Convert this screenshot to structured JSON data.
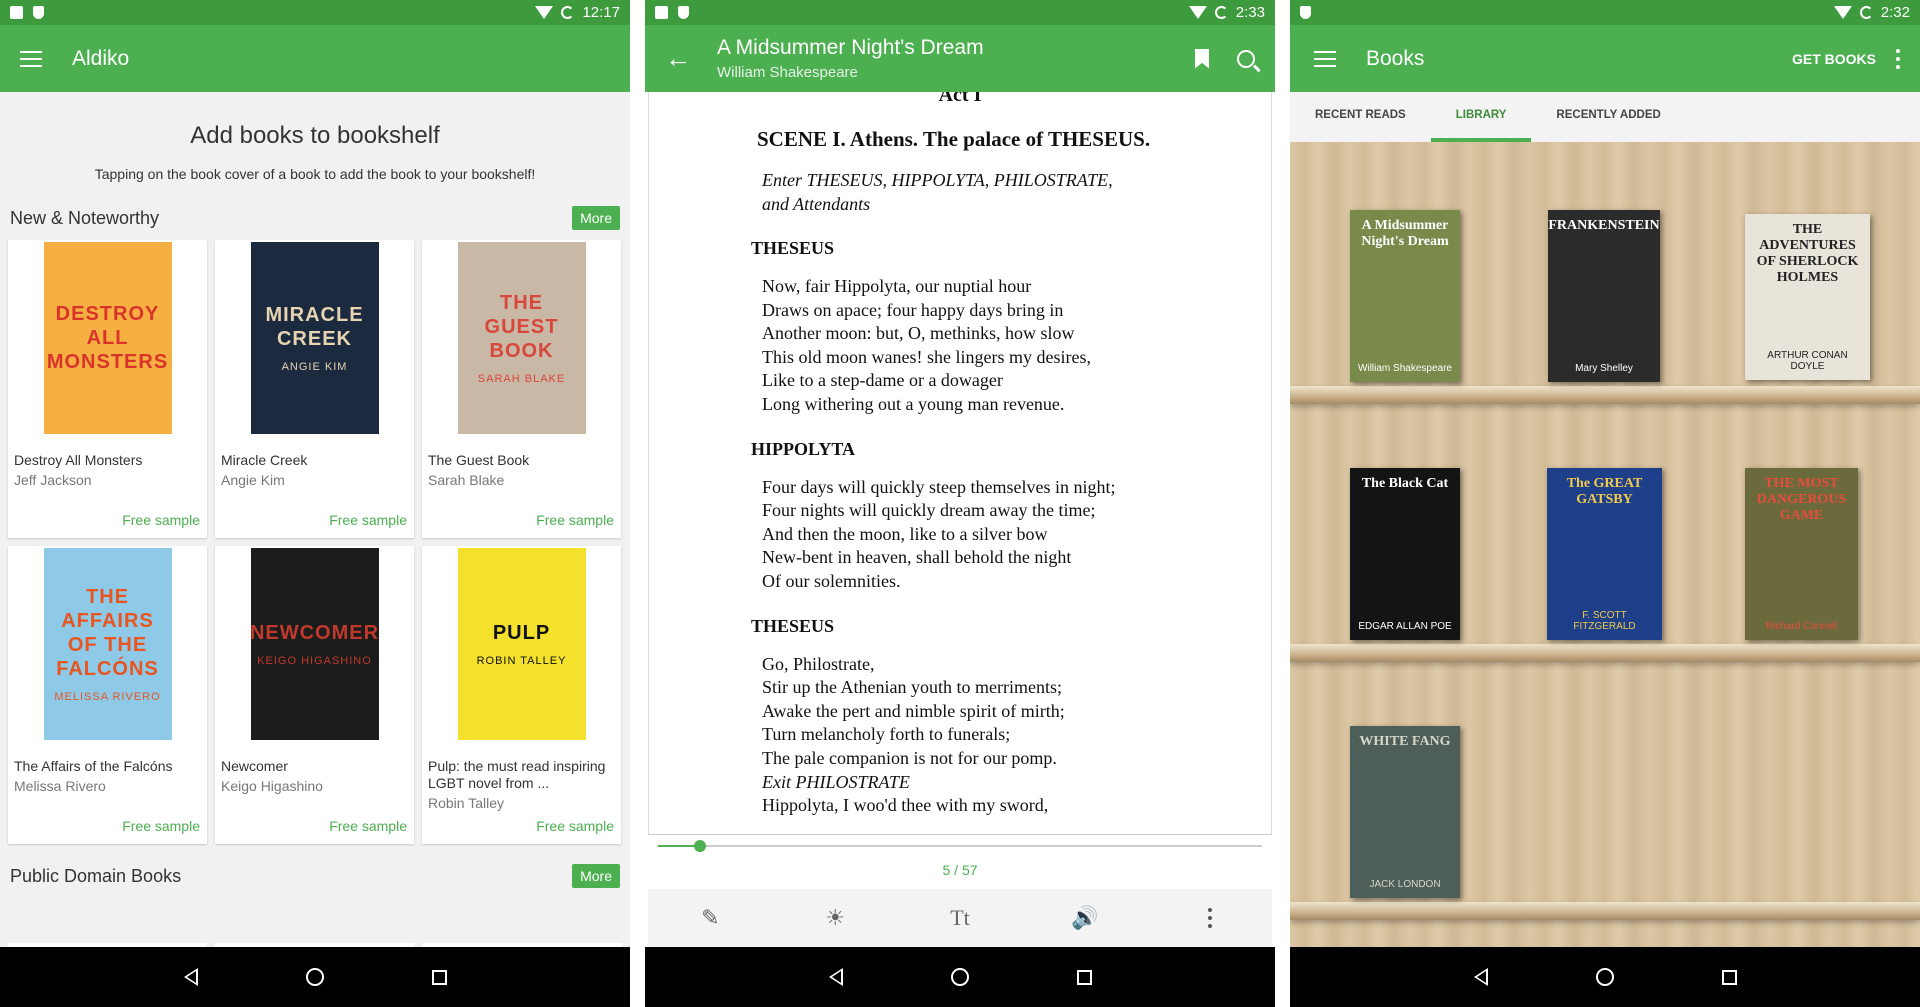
{
  "screen1": {
    "status": {
      "time": "12:17"
    },
    "appbar": {
      "title": "Aldiko"
    },
    "hero": {
      "title": "Add books to bookshelf",
      "subtitle": "Tapping on the book cover of a book to add the book to your bookshelf!"
    },
    "sections": [
      {
        "title": "New & Noteworthy",
        "more": "More"
      },
      {
        "title": "Public Domain Books",
        "more": "More"
      }
    ],
    "books": [
      {
        "title": "Destroy All Monsters",
        "author": "Jeff Jackson",
        "sample": "Free sample",
        "cover_text": "DESTROY ALL MONSTERS",
        "cover_color": "#f5b041",
        "cover_fg": "#d9342b"
      },
      {
        "title": "Miracle Creek",
        "author": "Angie Kim",
        "sample": "Free sample",
        "cover_text": "MIRACLE CREEK",
        "cover_sub": "ANGIE KIM",
        "cover_color": "#1b2a3e",
        "cover_fg": "#e6d3b0"
      },
      {
        "title": "The Guest Book",
        "author": "Sarah Blake",
        "sample": "Free sample",
        "cover_text": "THE GUEST BOOK",
        "cover_sub": "SARAH BLAKE",
        "cover_color": "#c9b8a6",
        "cover_fg": "#d9463a"
      },
      {
        "title": "The Affairs of the Falcóns",
        "author": "Melissa Rivero",
        "sample": "Free sample",
        "cover_text": "THE AFFAIRS OF THE FALCÓNS",
        "cover_sub": "MELISSA RIVERO",
        "cover_color": "#8fc9e8",
        "cover_fg": "#e8551f"
      },
      {
        "title": "Newcomer",
        "author": "Keigo Higashino",
        "sample": "Free sample",
        "cover_text": "NEWCOMER",
        "cover_sub": "KEIGO HIGASHINO",
        "cover_color": "#1c1c1c",
        "cover_fg": "#c0392b"
      },
      {
        "title": "Pulp: the must read inspiring LGBT novel from ...",
        "author": "Robin Talley",
        "sample": "Free sample",
        "cover_text": "PULP",
        "cover_sub": "ROBIN TALLEY",
        "cover_color": "#f4e12b",
        "cover_fg": "#111111"
      }
    ]
  },
  "screen2": {
    "status": {
      "time": "2:33"
    },
    "appbar": {
      "title": "A Midsummer Night's Dream",
      "author": "William Shakespeare"
    },
    "text": {
      "act": "Act I",
      "scene": "SCENE I. Athens. The palace of THESEUS.",
      "stage": [
        "Enter THESEUS, HIPPOLYTA, PHILOSTRATE,",
        "and Attendants"
      ],
      "speech1": {
        "speaker": "THESEUS",
        "lines": [
          "Now, fair Hippolyta, our nuptial hour",
          "Draws on apace; four happy days bring in",
          "Another moon: but, O, methinks, how slow",
          "This old moon wanes! she lingers my desires,",
          "Like to a step-dame or a dowager",
          "Long withering out a young man revenue."
        ]
      },
      "speech2": {
        "speaker": "HIPPOLYTA",
        "lines": [
          "Four days will quickly steep themselves in night;",
          "Four nights will quickly dream away the time;",
          "And then the moon, like to a silver bow",
          "New-bent in heaven, shall behold the night",
          "Of our solemnities."
        ]
      },
      "speech3": {
        "speaker": "THESEUS",
        "lines": [
          "Go, Philostrate,",
          "Stir up the Athenian youth to merriments;",
          "Awake the pert and nimble spirit of mirth;",
          "Turn melancholy forth to funerals;",
          "The pale companion is not for our pomp."
        ],
        "exit": "Exit PHILOSTRATE",
        "cut_line": "Hippolyta, I woo'd thee with my sword,"
      }
    },
    "progress": {
      "label": "5 / 57",
      "fraction": 0.0702
    },
    "toolbar": {
      "font_label": "Tt"
    }
  },
  "screen3": {
    "status": {
      "time": "2:32"
    },
    "appbar": {
      "title": "Books",
      "get_books": "GET BOOKS"
    },
    "tabs": [
      "RECENT READS",
      "LIBRARY",
      "RECENTLY ADDED"
    ],
    "active_tab": "LIBRARY",
    "shelf_books": [
      {
        "title": "A Midsummer Night's Dream",
        "author": "William Shakespeare",
        "color": "#7a8a4a",
        "fg": "#ffffff"
      },
      {
        "title": "FRANKENSTEIN",
        "author": "Mary Shelley",
        "color": "#2b2b2b",
        "fg": "#ffffff"
      },
      {
        "title": "THE ADVENTURES OF SHERLOCK HOLMES",
        "author": "ARTHUR CONAN DOYLE",
        "color": "#e9e4da",
        "fg": "#222222"
      },
      {
        "title": "The Black Cat",
        "author": "EDGAR ALLAN POE",
        "color": "#141414",
        "fg": "#ffffff"
      },
      {
        "title": "The GREAT GATSBY",
        "author": "F. SCOTT FITZGERALD",
        "color": "#1e3f8a",
        "fg": "#f2c94c"
      },
      {
        "title": "THE MOST DANGEROUS GAME",
        "author": "Richard Connell",
        "color": "#6b6a3c",
        "fg": "#e74c3c"
      },
      {
        "title": "WHITE FANG",
        "author": "JACK LONDON",
        "color": "#4e5e58",
        "fg": "#d6d6c8"
      }
    ]
  },
  "colors": {
    "accent": "#4caf50",
    "statusbar": "#3d9a3d"
  }
}
